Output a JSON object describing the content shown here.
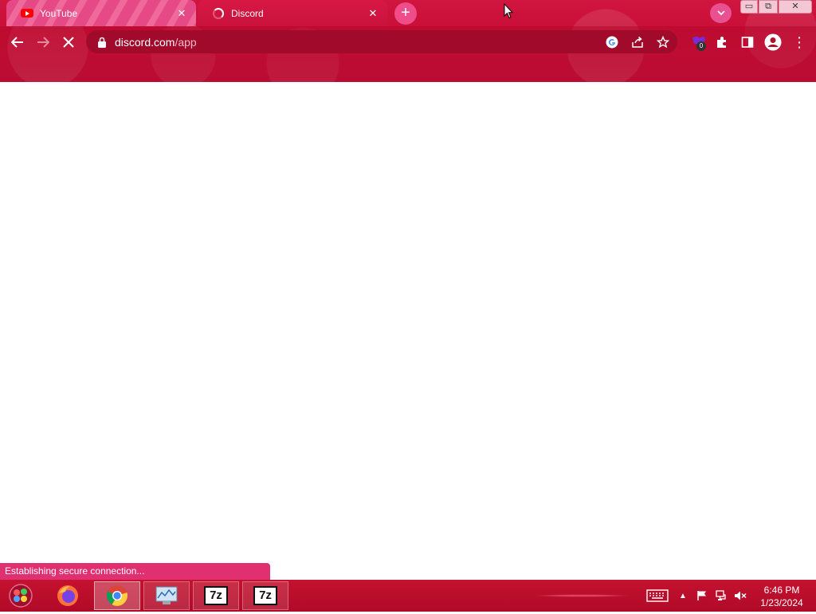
{
  "browser": {
    "tabs": [
      {
        "title": "YouTube",
        "favicon": "youtube-icon",
        "active": false
      },
      {
        "title": "Discord",
        "favicon": "loading-spinner-icon",
        "active": true
      }
    ],
    "tab_close_glyph": "✕",
    "new_tab_glyph": "+",
    "tab_search_glyph": "⌄",
    "window_controls": {
      "minimize": "▭",
      "maximize": "⧉",
      "close": "✕"
    },
    "nav": {
      "back": "←",
      "forward": "→",
      "stop": "✕"
    },
    "address_bar": {
      "host": "discord.com",
      "path": "/app"
    },
    "extension_badge_count": "0",
    "menu_glyph": "⋮",
    "status_text": "Establishing secure connection...",
    "theme_color": "#c8123c"
  },
  "taskbar": {
    "apps": [
      {
        "name": "firefox-icon"
      },
      {
        "name": "chrome-icon",
        "active": true
      },
      {
        "name": "task-manager-icon"
      },
      {
        "name": "7zip-icon",
        "label": "7z"
      },
      {
        "name": "7zip-icon",
        "label": "7z"
      }
    ],
    "tray_chevron": "▲",
    "clock": {
      "time": "6:46 PM",
      "date": "1/23/2024"
    }
  }
}
